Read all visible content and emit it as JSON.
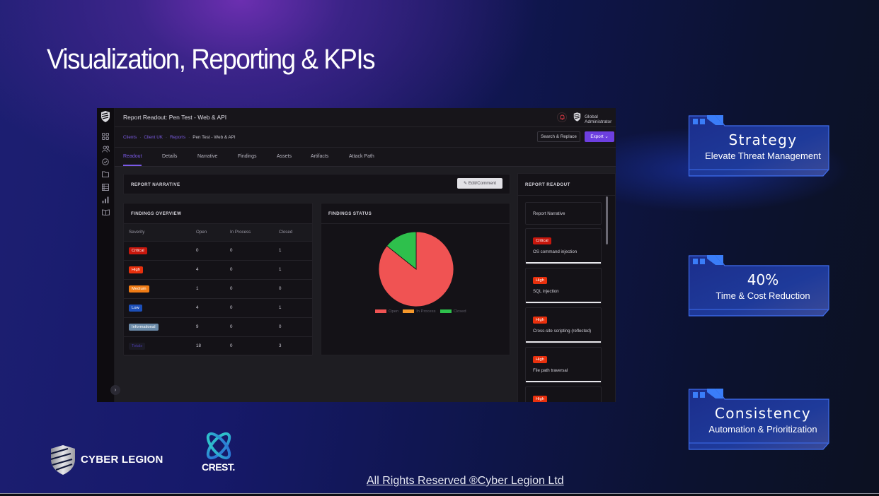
{
  "slide": {
    "title": "Visualization, Reporting & KPIs",
    "footer": "All Rights Reserved ®Cyber Legion Ltd"
  },
  "app": {
    "page_title": "Report Readout: Pen Test - Web & API",
    "user": "Global Administrator",
    "breadcrumb": [
      "Clients",
      "Client UK",
      "Reports",
      "Pen Test - Web & API"
    ],
    "search_replace_label": "Search & Replace",
    "export_label": "Export",
    "rail_icons": [
      "dashboard-icon",
      "users-icon",
      "check-circle-icon",
      "folder-icon",
      "list-icon",
      "bar-chart-icon",
      "book-icon"
    ],
    "tabs": [
      {
        "label": "Readout",
        "active": true
      },
      {
        "label": "Details",
        "active": false
      },
      {
        "label": "Narrative",
        "active": false
      },
      {
        "label": "Findings",
        "active": false
      },
      {
        "label": "Assets",
        "active": false
      },
      {
        "label": "Artifacts",
        "active": false
      },
      {
        "label": "Attack Path",
        "active": false
      }
    ],
    "report_narrative": {
      "title": "REPORT NARRATIVE",
      "edit_label": "Edit/Comment"
    },
    "findings_overview": {
      "title": "FINDINGS OVERVIEW",
      "columns": [
        "Severity",
        "Open",
        "In Process",
        "Closed"
      ],
      "rows": [
        {
          "severity": "Critical",
          "color": "#c8170d",
          "open": "0",
          "in_process": "0",
          "closed": "1"
        },
        {
          "severity": "High",
          "color": "#e8300d",
          "open": "4",
          "in_process": "0",
          "closed": "1"
        },
        {
          "severity": "Medium",
          "color": "#f07c16",
          "open": "1",
          "in_process": "0",
          "closed": "0"
        },
        {
          "severity": "Low",
          "color": "#1c4fb8",
          "open": "4",
          "in_process": "0",
          "closed": "1"
        },
        {
          "severity": "Informational",
          "color": "#6a8aa8",
          "open": "9",
          "in_process": "0",
          "closed": "0"
        },
        {
          "severity": "Totals",
          "color": "#1b1a24",
          "open": "18",
          "in_process": "0",
          "closed": "3"
        }
      ]
    },
    "findings_status": {
      "title": "FINDINGS STATUS"
    },
    "report_readout": {
      "title": "REPORT READOUT",
      "items": [
        {
          "badge": "",
          "text": "Report Narrative"
        },
        {
          "badge": "Critical",
          "color": "#c8170d",
          "text": "OS command injection"
        },
        {
          "badge": "High",
          "color": "#e8300d",
          "text": "SQL injection"
        },
        {
          "badge": "High",
          "color": "#e8300d",
          "text": "Cross-site scripting (reflected)"
        },
        {
          "badge": "High",
          "color": "#e8300d",
          "text": "File path traversal"
        },
        {
          "badge": "High",
          "color": "#e8300d",
          "text": ""
        }
      ]
    }
  },
  "chart_data": {
    "type": "pie",
    "title": "FINDINGS STATUS",
    "categories": [
      "Open",
      "In Process",
      "Closed"
    ],
    "values": [
      18,
      0,
      3
    ],
    "colors": [
      "#f05353",
      "#f5982b",
      "#2ec04c"
    ],
    "legend": "bottom"
  },
  "kpis": [
    {
      "title": "Strategy",
      "subtitle": "Elevate Threat Management"
    },
    {
      "title": "40%",
      "subtitle": "Time & Cost Reduction"
    },
    {
      "title": "Consistency",
      "subtitle": "Automation & Prioritization"
    }
  ],
  "logos": {
    "brand": "CYBER LEGION",
    "crest": "CREST."
  }
}
